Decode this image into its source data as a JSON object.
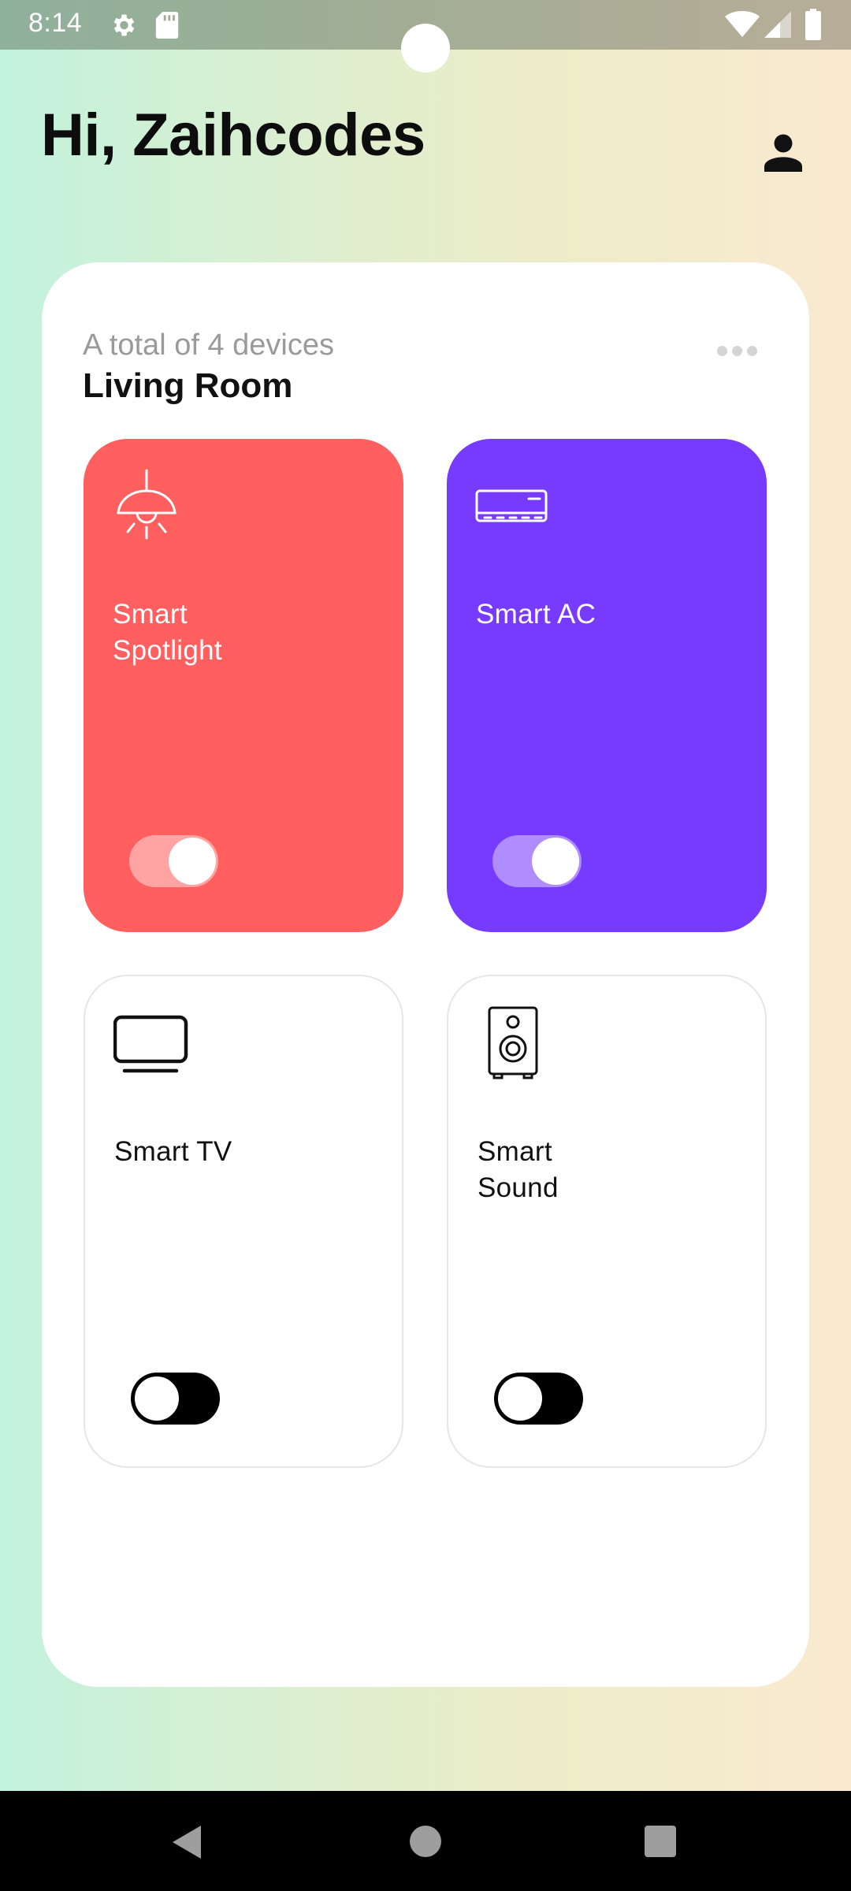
{
  "status_bar": {
    "time": "8:14",
    "icons": [
      "gear-icon",
      "sd-card-icon",
      "wifi-icon",
      "signal-icon",
      "battery-icon"
    ]
  },
  "header": {
    "greeting": "Hi, Zaihcodes",
    "profile_icon": "person-icon"
  },
  "room": {
    "device_count_text": "A total of 4 devices",
    "name": "Living Room",
    "more_icon": "more-horizontal-icon",
    "devices": [
      {
        "name": "Smart\nSpotlight",
        "icon": "ceiling-lamp-icon",
        "on": true,
        "color": "#ff5f5f",
        "toggle_track": "#ffa3a3"
      },
      {
        "name": "Smart AC",
        "icon": "air-conditioner-icon",
        "on": true,
        "color": "#773bff",
        "toggle_track": "#b08dff"
      },
      {
        "name": "Smart TV",
        "icon": "tv-icon",
        "on": false,
        "color": "#ffffff",
        "toggle_track": "#000000"
      },
      {
        "name": "Smart\nSound",
        "icon": "speaker-icon",
        "on": false,
        "color": "#ffffff",
        "toggle_track": "#000000"
      }
    ]
  },
  "nav_bar": {
    "icons": [
      "back-icon",
      "home-icon",
      "recents-icon"
    ]
  }
}
